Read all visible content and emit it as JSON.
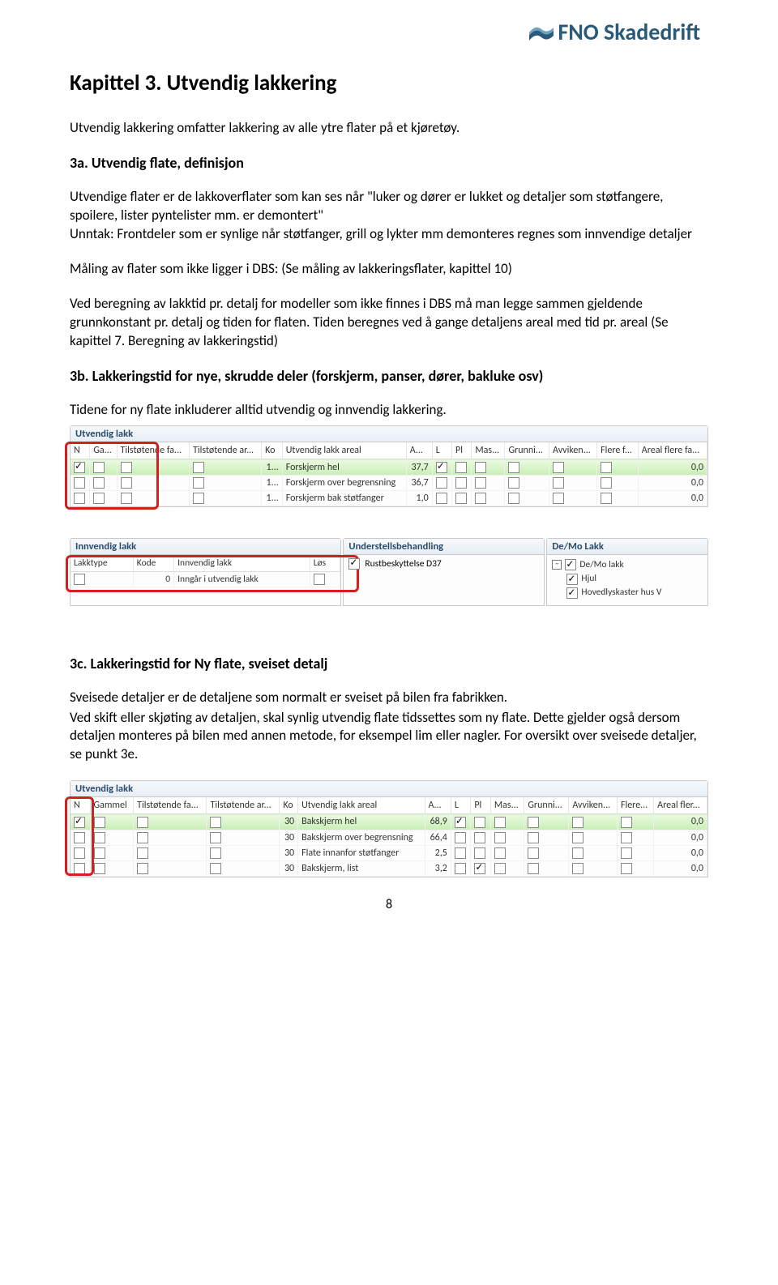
{
  "logo_text": "FNO Skadedrift",
  "h1": "Kapittel 3. Utvendig lakkering",
  "p_intro": "Utvendig lakkering omfatter lakkering av alle ytre flater på et kjøretøy.",
  "h2_3a": "3a. Utvendig flate, definisjon",
  "p_3a_1": "Utvendige flater er de lakkoverflater som kan ses når \"luker og dører er lukket og  detaljer som støtfangere, spoilere, lister pyntelister mm. er demontert\"",
  "p_3a_2": "Unntak: Frontdeler som er synlige når støtfanger, grill og lykter mm demonteres regnes som innvendige detaljer",
  "p_3a_3": "Måling av flater som ikke ligger i DBS: (Se måling av lakkeringsflater, kapittel 10)",
  "p_3a_4": "Ved beregning av lakktid pr. detalj for modeller som ikke finnes i DBS må man legge sammen gjeldende grunnkonstant pr. detalj og tiden for flaten. Tiden beregnes ved å gange detaljens areal med tid pr. areal (Se kapittel 7. Beregning av lakkeringstid)",
  "h2_3b": "3b. Lakkeringstid for nye, skrudde deler (forskjerm, panser, dører, bakluke osv)",
  "p_3b": "Tidene for ny flate inkluderer alltid utvendig og innvendig lakkering.",
  "sc1": {
    "title": "Utvendig lakk",
    "headers": [
      "N",
      "Ga...",
      "Tilstøtende  fa...",
      "Tilstøtende  ar...",
      "Ko",
      "Utvendig lakk areal",
      "A...",
      "L",
      "Pl",
      "Mas...",
      "Grunni...",
      "Avviken...",
      "Flere f...",
      "Areal flere fa..."
    ],
    "rows": [
      {
        "n": true,
        "ga": false,
        "tf": false,
        "ta": false,
        "ko": "1...",
        "txt": "Forskjerm hel",
        "a": "37,7",
        "l": true,
        "pl": false,
        "mas": false,
        "gr": false,
        "av": false,
        "ff": false,
        "af": "0,0",
        "hl": true
      },
      {
        "n": false,
        "ga": false,
        "tf": false,
        "ta": false,
        "ko": "1...",
        "txt": "Forskjerm over begrensning",
        "a": "36,7",
        "l": false,
        "pl": false,
        "mas": false,
        "gr": false,
        "av": false,
        "ff": false,
        "af": "0,0",
        "hl": false
      },
      {
        "n": false,
        "ga": false,
        "tf": false,
        "ta": false,
        "ko": "1...",
        "txt": "Forskjerm bak støtfanger",
        "a": "1,0",
        "l": false,
        "pl": false,
        "mas": false,
        "gr": false,
        "av": false,
        "ff": false,
        "af": "0,0",
        "hl": false
      }
    ],
    "inn": {
      "title": "Innvendig lakk",
      "headers": [
        "Lakktype",
        "Kode",
        "Innvendig lakk",
        "Løs"
      ],
      "row": {
        "lakktype": "",
        "kode": "0",
        "txt": "Inngår i utvendig lakk",
        "los": false
      }
    },
    "under": {
      "title": "Understellsbehandling",
      "row": {
        "chk": true,
        "txt": "Rustbeskyttelse D37"
      }
    },
    "demo": {
      "title": "De/Mo Lakk",
      "root": "De/Mo lakk",
      "items": [
        "Hjul",
        "Hovedlyskaster hus V"
      ]
    }
  },
  "h2_3c": "3c. Lakkeringstid for Ny flate, sveiset detalj",
  "p_3c_1": "Sveisede detaljer er de detaljene som normalt er sveiset på bilen fra fabrikken.",
  "p_3c_2": "Ved skift eller skjøting av detaljen, skal synlig utvendig flate tidssettes som ny flate. Dette gjelder også dersom detaljen monteres på bilen med annen metode, for eksempel lim eller nagler. For oversikt over sveisede detaljer, se punkt 3e.",
  "sc2": {
    "title": "Utvendig lakk",
    "headers": [
      "N",
      "Gammel",
      "Tilstøtende  fa...",
      "Tilstøtende  ar...",
      "Ko",
      "Utvendig lakk areal",
      "A...",
      "L",
      "Pl",
      "Mas...",
      "Grunni...",
      "Avviken...",
      "Flere...",
      "Areal fler..."
    ],
    "rows": [
      {
        "n": true,
        "ga": false,
        "tf": false,
        "ta": false,
        "ko": "30",
        "txt": "Bakskjerm hel",
        "a": "68,9",
        "l": true,
        "pl": false,
        "mas": false,
        "gr": false,
        "av": false,
        "ff": false,
        "af": "0,0",
        "hl": true
      },
      {
        "n": false,
        "ga": false,
        "tf": false,
        "ta": false,
        "ko": "30",
        "txt": "Bakskjerm over begrensning",
        "a": "66,4",
        "l": false,
        "pl": false,
        "mas": false,
        "gr": false,
        "av": false,
        "ff": false,
        "af": "0,0",
        "hl": false
      },
      {
        "n": false,
        "ga": false,
        "tf": false,
        "ta": false,
        "ko": "30",
        "txt": "Flate innanfor støtfanger",
        "a": "2,5",
        "l": false,
        "pl": false,
        "mas": false,
        "gr": false,
        "av": false,
        "ff": false,
        "af": "0,0",
        "hl": false
      },
      {
        "n": false,
        "ga": false,
        "tf": false,
        "ta": false,
        "ko": "30",
        "txt": "Bakskjerm, list",
        "a": "3,2",
        "l": false,
        "pl": true,
        "mas": false,
        "gr": false,
        "av": false,
        "ff": false,
        "af": "0,0",
        "hl": false
      }
    ]
  },
  "page_number": "8"
}
